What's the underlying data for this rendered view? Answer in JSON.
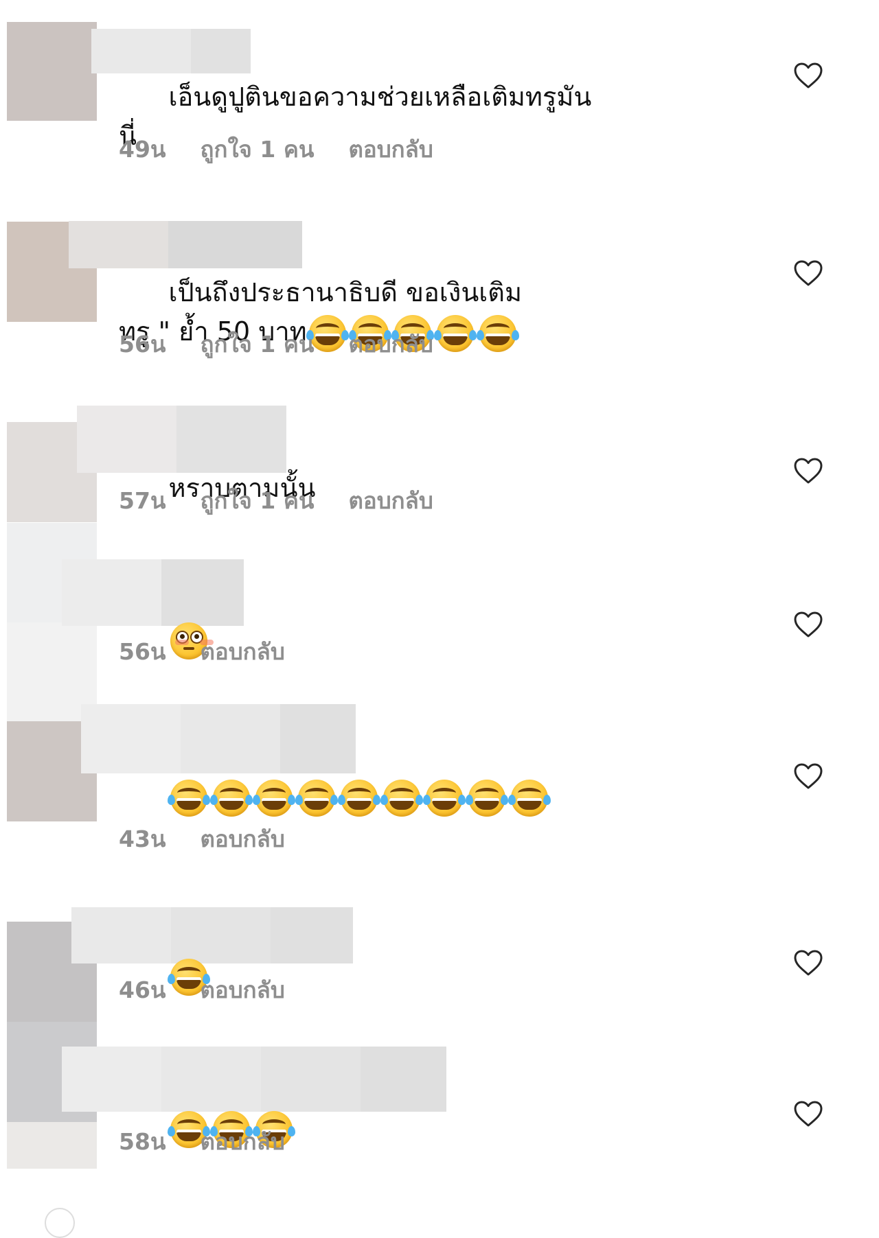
{
  "comments": [
    {
      "text": "เอ็นดูปูตินขอความช่วยเหลือเติมทรูมัน\nนี่",
      "emoji_count": 0,
      "emoji_type": "",
      "time": "49น",
      "likes": "ถูกใจ 1 คน",
      "reply": "ตอบกลับ"
    },
    {
      "text": "เป็นถึงประธานาธิบดี ขอเงินเติม\nทรู \" ย้ำ 50 บาท",
      "emoji_count": 5,
      "emoji_type": "face-with-tears-of-joy",
      "time": "56น",
      "likes": "ถูกใจ 1 คน",
      "reply": "ตอบกลับ"
    },
    {
      "text": "หราบตามนั้น",
      "emoji_count": 0,
      "emoji_type": "",
      "time": "57น",
      "likes": "ถูกใจ 1 คน",
      "reply": "ตอบกลับ"
    },
    {
      "text": "",
      "emoji_count": 1,
      "emoji_type": "flushed-face",
      "time": "56น",
      "likes": "",
      "reply": "ตอบกลับ"
    },
    {
      "text": "",
      "emoji_count": 9,
      "emoji_type": "face-with-tears-of-joy",
      "time": "43น",
      "likes": "",
      "reply": "ตอบกลับ"
    },
    {
      "text": "",
      "emoji_count": 1,
      "emoji_type": "face-with-tears-of-joy",
      "time": "46น",
      "likes": "",
      "reply": "ตอบกลับ"
    },
    {
      "text": "",
      "emoji_count": 3,
      "emoji_type": "face-with-tears-of-joy",
      "time": "58น",
      "likes": "",
      "reply": "ตอบกลับ"
    }
  ],
  "icons": {
    "like": "heart-outline-icon",
    "avatar": "blurred-avatar"
  },
  "colors": {
    "text": "#111111",
    "meta": "#8e8e8e",
    "heart": "#262626",
    "background": "#ffffff",
    "redaction": "#e6e6e6"
  }
}
